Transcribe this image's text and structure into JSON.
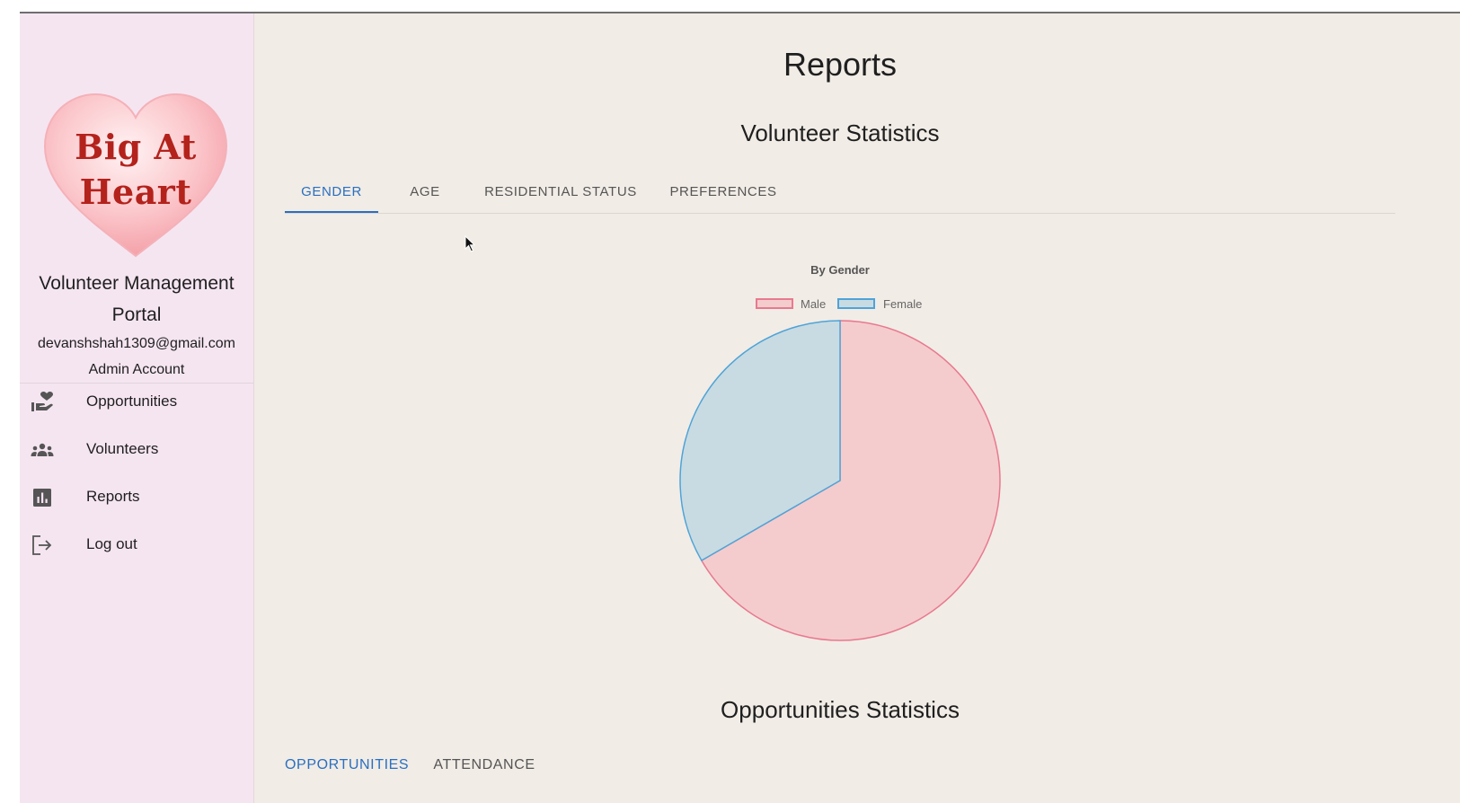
{
  "sidebar": {
    "logo": {
      "line1": "Big At",
      "line2": "Heart"
    },
    "portal_title": "Volunteer Management Portal",
    "email": "devanshshah1309@gmail.com",
    "role": "Admin Account",
    "nav": [
      {
        "label": "Opportunities",
        "icon": "volunteer-activism-icon"
      },
      {
        "label": "Volunteers",
        "icon": "groups-icon"
      },
      {
        "label": "Reports",
        "icon": "bar-chart-icon"
      },
      {
        "label": "Log out",
        "icon": "logout-icon"
      }
    ]
  },
  "main": {
    "page_title": "Reports",
    "volunteer_section": {
      "title": "Volunteer Statistics",
      "tabs": [
        {
          "label": "GENDER",
          "active": true
        },
        {
          "label": "AGE",
          "active": false
        },
        {
          "label": "RESIDENTIAL STATUS",
          "active": false
        },
        {
          "label": "PREFERENCES",
          "active": false
        }
      ]
    },
    "opportunities_section": {
      "title": "Opportunities Statistics",
      "tabs": [
        {
          "label": "OPPORTUNITIES",
          "active": true
        },
        {
          "label": "ATTENDANCE",
          "active": false
        }
      ]
    }
  },
  "colors": {
    "accent": "#2a6fc0",
    "male_fill": "#f4cccd",
    "male_border": "#e8798f",
    "female_fill": "#c8dbe2",
    "female_border": "#4ea3d8"
  },
  "chart_data": {
    "type": "pie",
    "title": "By Gender",
    "categories": [
      "Male",
      "Female"
    ],
    "values": [
      2,
      1
    ],
    "legend_position": "top"
  }
}
